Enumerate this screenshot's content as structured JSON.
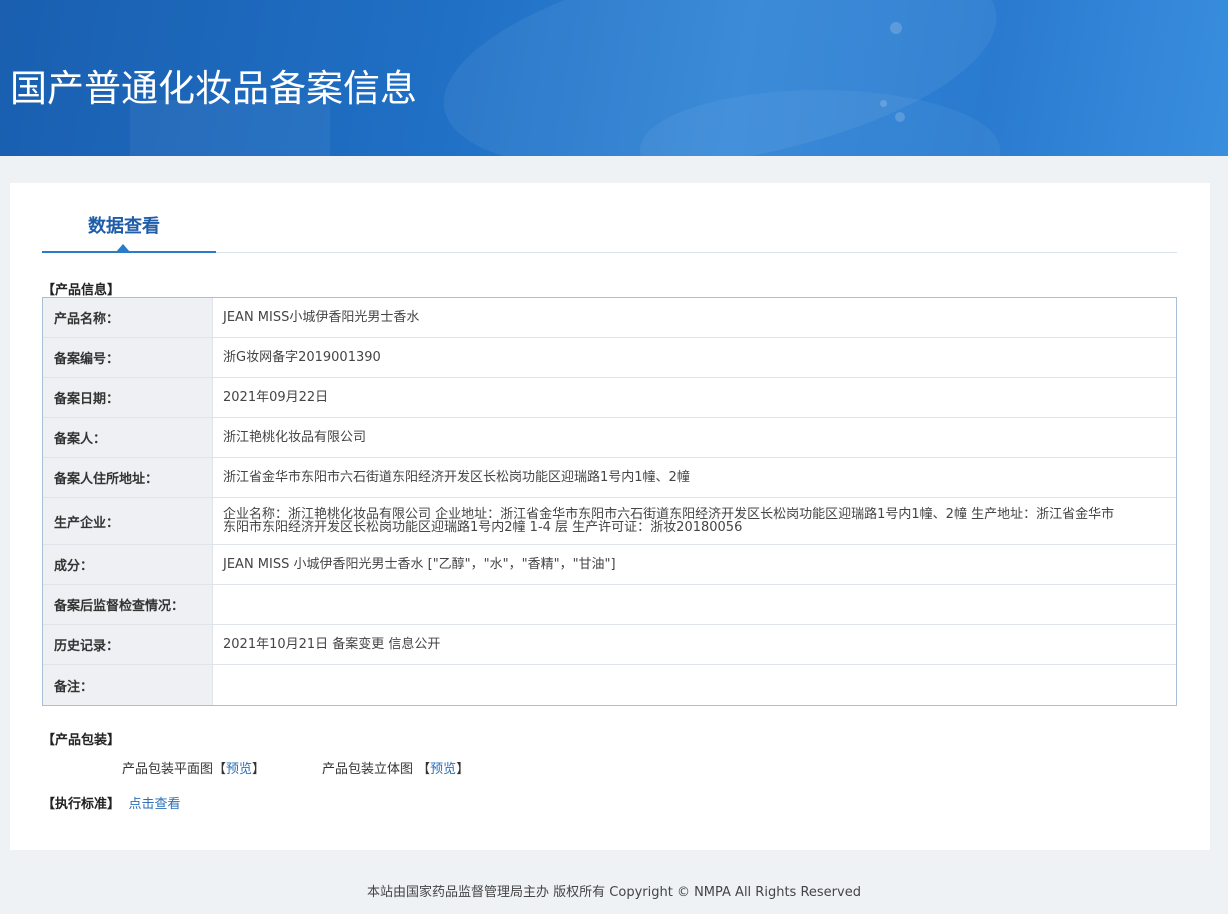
{
  "header": {
    "title": "国产普通化妆品备案信息"
  },
  "tabs": [
    {
      "label": "数据查看"
    }
  ],
  "product_info": {
    "section_label": "【产品信息】",
    "rows": [
      {
        "key": "产品名称：",
        "value": "JEAN MISS小城伊香阳光男士香水"
      },
      {
        "key": "备案编号：",
        "value": "浙G妆网备字2019001390"
      },
      {
        "key": "备案日期：",
        "value": "2021年09月22日"
      },
      {
        "key": "备案人：",
        "value": "浙江艳桃化妆品有限公司"
      },
      {
        "key": "备案人住所地址：",
        "value": "浙江省金华市东阳市六石街道东阳经济开发区长松岗功能区迎瑞路1号内1幢、2幢"
      },
      {
        "key": "生产企业：",
        "value": "企业名称：浙江艳桃化妆品有限公司 企业地址：浙江省金华市东阳市六石街道东阳经济开发区长松岗功能区迎瑞路1号内1幢、2幢 生产地址：浙江省金华市东阳市东阳经济开发区长松岗功能区迎瑞路1号内2幢 1-4 层 生产许可证：浙妆20180056"
      },
      {
        "key": "成分：",
        "value": "JEAN MISS 小城伊香阳光男士香水 [\"乙醇\"，\"水\"，\"香精\"，\"甘油\"]"
      },
      {
        "key": "备案后监督检查情况：",
        "value": ""
      },
      {
        "key": "历史记录：",
        "value": "2021年10月21日 备案变更 信息公开"
      },
      {
        "key": "备注：",
        "value": ""
      }
    ]
  },
  "packaging": {
    "section_label": "【产品包装】",
    "flat_label": "产品包装平面图",
    "flat_bracket_open": "【",
    "flat_link": "预览",
    "flat_bracket_close": "】",
    "stereo_label": "产品包装立体图",
    "stereo_bracket_open": "【",
    "stereo_link": "预览",
    "stereo_bracket_close": "】"
  },
  "standard": {
    "section_label": "【执行标准】",
    "link": "点击查看"
  },
  "footer": {
    "text": "本站由国家药品监督管理局主办 版权所有 Copyright © NMPA All Rights Reserved"
  },
  "colors": {
    "banner": "#1f6fc4",
    "tab_accent": "#2a7bc8",
    "link": "#2a6fb8",
    "table_border": "#a9bfd8",
    "key_bg": "#eef0f3"
  }
}
